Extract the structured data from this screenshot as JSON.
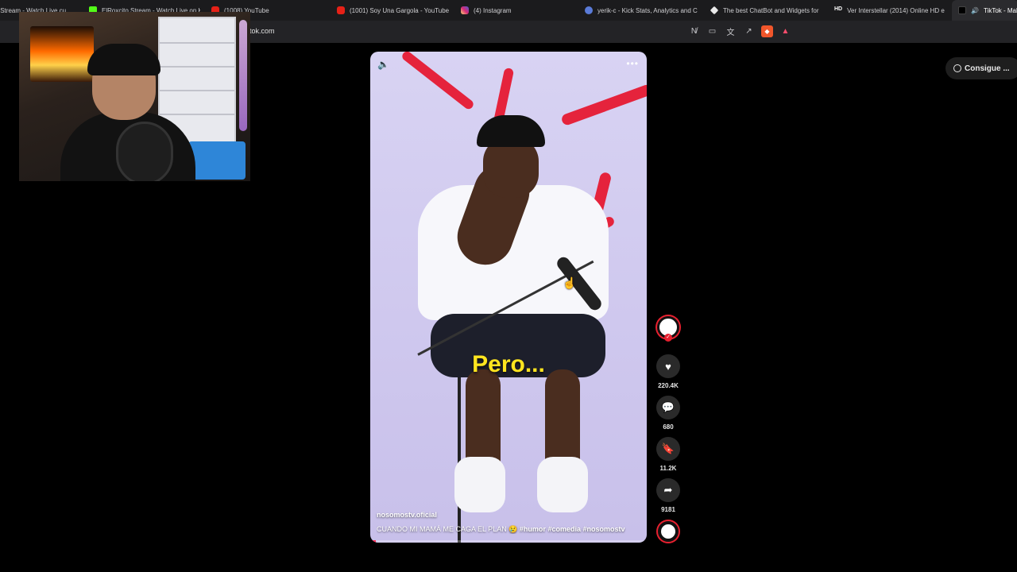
{
  "browser": {
    "tabs": [
      {
        "title": "c Stream - Watch Live cu",
        "icon": "generic-icon"
      },
      {
        "title": "ElRoxcito Stream - Watch Live on K",
        "icon": "kick-icon"
      },
      {
        "title": "(1008) YouTube",
        "icon": "youtube-icon"
      },
      {
        "title": "(1001) Soy Una Gargola - YouTube",
        "icon": "youtube-icon"
      },
      {
        "title": "(4) Instagram",
        "icon": "instagram-icon"
      },
      {
        "title": "yerik-c - Kick Stats, Analytics and C",
        "icon": "stats-icon"
      },
      {
        "title": "The best ChatBot and Widgets for",
        "icon": "diamond-icon"
      },
      {
        "title": "Ver Interstellar (2014) Online HD e",
        "icon": "hd-icon"
      },
      {
        "title": "TikTok - Make",
        "icon": "tiktok-icon"
      }
    ],
    "address": "tok.com",
    "hd_badge": "HD"
  },
  "video": {
    "caption_overlay": "Pero...",
    "username": "nosomostv.oficial",
    "description": "CUANDO MI MAMÁ ME CAGA EL PLAN 😢",
    "hashtags": [
      "#humor",
      "#comedia",
      "#nosomostv"
    ],
    "progress": 0.02,
    "more_label": "•••"
  },
  "actions": {
    "likes": "220.4K",
    "comments": "680",
    "saves": "11.2K",
    "shares": "9181"
  },
  "get_app": {
    "label": "Consigue ..."
  },
  "colors": {
    "accent": "#fe2c55",
    "caption": "#ffe51f",
    "background": "#000000"
  }
}
